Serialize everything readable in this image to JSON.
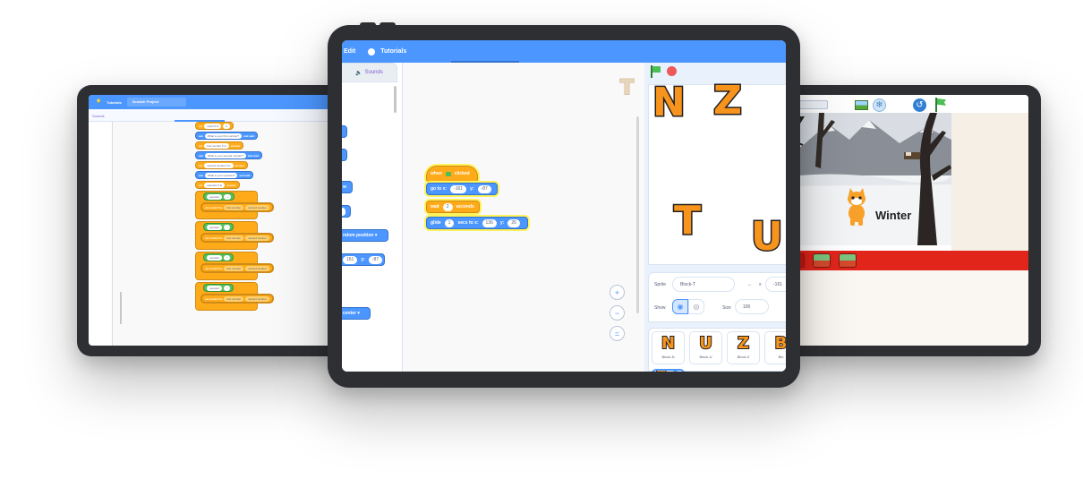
{
  "left_tablet": {
    "menu_tutorials": "Tutorials",
    "project_title": "Scratch Project",
    "tab_sounds": "Sounds",
    "blocks": [
      {
        "k": "set",
        "txt": "result ▾ to",
        "val": "0"
      },
      {
        "k": "ask",
        "txt": "What is your first number?",
        "tail": "and wait"
      },
      {
        "k": "set",
        "txt": "first number ▾ to",
        "tail": "answer"
      },
      {
        "k": "ask",
        "txt": "What is your second number?",
        "tail": "and wait"
      },
      {
        "k": "set",
        "txt": "second number ▾ to",
        "tail": "answer"
      },
      {
        "k": "ask",
        "txt": "What is your operator?",
        "tail": "and wait"
      },
      {
        "k": "set",
        "txt": "operator ▾ to",
        "tail": "answer"
      }
    ],
    "if_blocks": [
      {
        "cond": "operator",
        "op": "+",
        "body": "set result ▾ to",
        "a": "first number",
        "b": "second number"
      },
      {
        "cond": "operator",
        "op": "-",
        "body": "set result ▾ to",
        "a": "first number",
        "b": "second number"
      },
      {
        "cond": "operator",
        "op": "*",
        "body": "set result ▾ to",
        "a": "first number",
        "b": "second number"
      },
      {
        "cond": "operator",
        "op": "/",
        "body": "set result ▾ to",
        "a": "first number",
        "b": "second number"
      }
    ]
  },
  "center_tablet": {
    "menu_edit": "Edit",
    "menu_tutorials": "Tutorials",
    "tab_sounds": "Sounds",
    "palette_random_position": "ndom position ▾",
    "palette_x": "161",
    "palette_y": "-87",
    "palette_center": "center ▾",
    "script": {
      "hat": "when",
      "hat_tail": "clicked",
      "goto_label": "go to x:",
      "goto_x": "-161",
      "goto_y_label": "y:",
      "goto_y": "-87",
      "wait_label": "wait",
      "wait_val": "2",
      "wait_tail": "seconds",
      "glide_label": "glide",
      "glide_val": "1",
      "glide_mid": "secs to x:",
      "glide_x": "136",
      "glide_y_label": "y:",
      "glide_y": "26"
    },
    "code_corner_letter": "T",
    "stage_letters": [
      "N",
      "Z",
      "T",
      "U"
    ],
    "sprite_info": {
      "sprite_label": "Sprite",
      "sprite_name": "Block-T",
      "x_label": "x",
      "x_value": "-161",
      "show_label": "Show",
      "size_label": "Size",
      "size_value": "100"
    },
    "sprites": [
      {
        "letter": "N",
        "name": "Block-N"
      },
      {
        "letter": "U",
        "name": "Block-U"
      },
      {
        "letter": "Z",
        "name": "Block-Z"
      },
      {
        "letter": "B",
        "name": "Blo"
      }
    ],
    "zoom_in": "+",
    "zoom_out": "−",
    "zoom_reset": "="
  },
  "right_tablet": {
    "stage_caption": "Winter"
  },
  "colors": {
    "scratch_blue": "#4c97ff",
    "control_orange": "#ffab19",
    "operator_green": "#59c059",
    "letter_orange": "#f7941d",
    "red_bar": "#e1251b"
  }
}
